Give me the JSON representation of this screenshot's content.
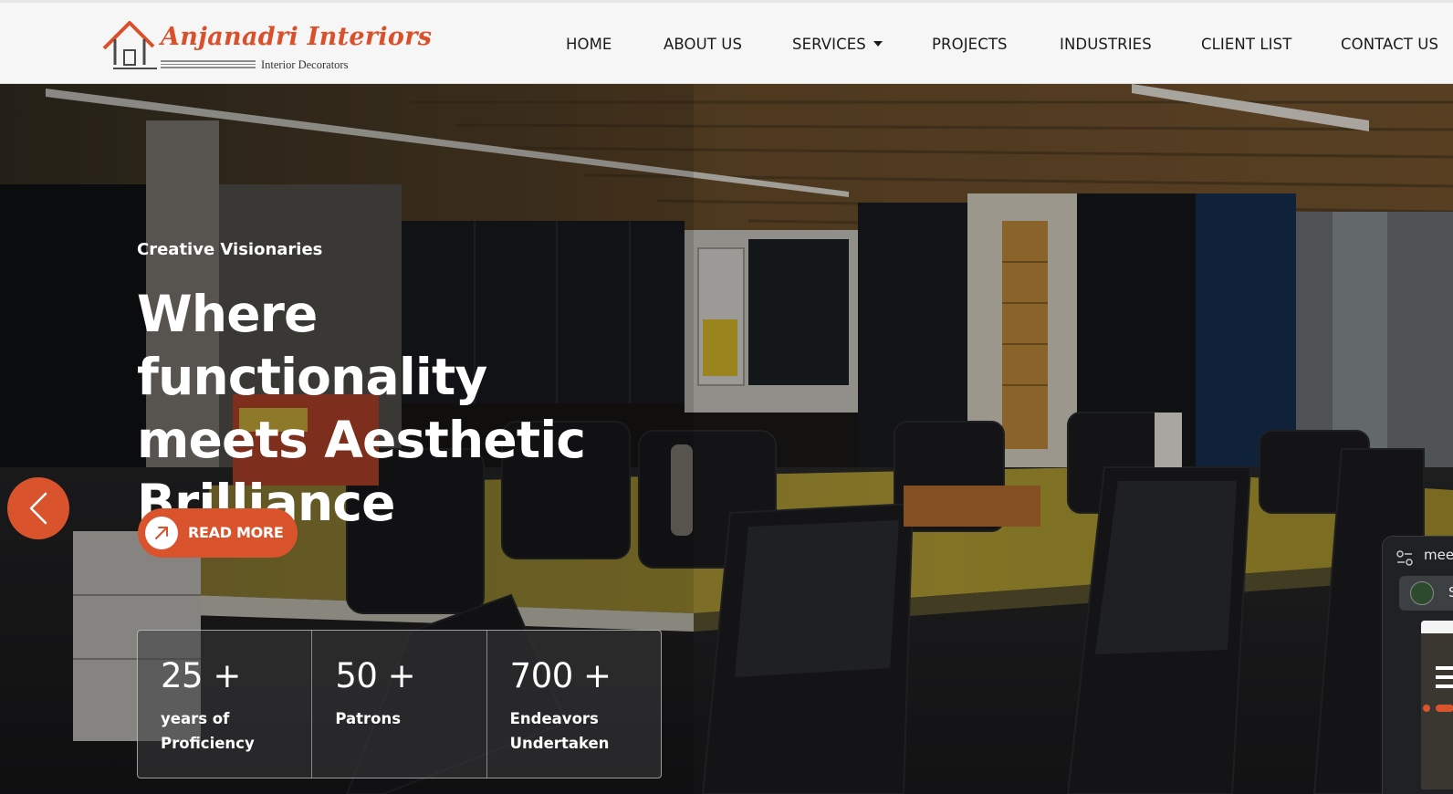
{
  "brand": {
    "name": "Anjanadri Interiors",
    "tagline": "Interior Decorators",
    "accent": "#d9542c"
  },
  "nav": {
    "items": [
      {
        "label": "HOME"
      },
      {
        "label": "ABOUT US"
      },
      {
        "label": "SERVICES",
        "has_dropdown": true
      },
      {
        "label": "PROJECTS"
      },
      {
        "label": "INDUSTRIES"
      },
      {
        "label": "CLIENT LIST"
      },
      {
        "label": "CONTACT US"
      }
    ]
  },
  "hero": {
    "eyebrow": "Creative Visionaries",
    "headline": "Where functionality meets Aesthetic Brilliance",
    "cta_label": "READ MORE",
    "prev_icon": "chevron-left-icon",
    "cta_icon": "arrow-up-right-icon"
  },
  "stats": [
    {
      "value": "25 +",
      "label": "years of Proficiency"
    },
    {
      "value": "50 +",
      "label": "Patrons"
    },
    {
      "value": "700 +",
      "label": "Endeavors Undertaken"
    }
  ],
  "meet_widget": {
    "title": "meet",
    "participant_initial": "S",
    "icon": "settings-sliders-icon"
  }
}
